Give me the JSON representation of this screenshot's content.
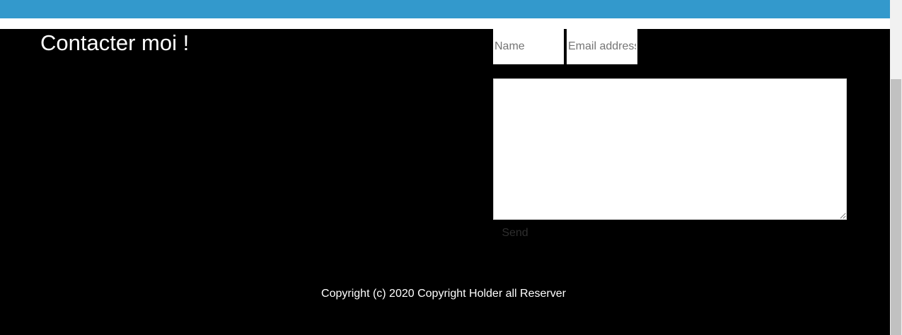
{
  "contact": {
    "heading": "Contacter moi !",
    "name_placeholder": "Name",
    "email_placeholder": "Email address",
    "message_value": "",
    "send_label": "Send"
  },
  "footer": {
    "copyright": "Copyright (c) 2020 Copyright Holder all Reserver"
  },
  "colors": {
    "top_bar": "#3399cc",
    "background": "#000000",
    "text": "#ffffff"
  }
}
